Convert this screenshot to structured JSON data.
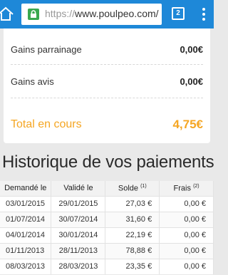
{
  "browser": {
    "url_scheme": "https://",
    "url_host": "www.poulpeo.com/",
    "tab_count": "2"
  },
  "summary": {
    "rows": [
      {
        "label": "Gains parrainage",
        "value": "0,00€"
      },
      {
        "label": "Gains avis",
        "value": "0,00€"
      }
    ],
    "total_label": "Total en cours",
    "total_value": "4,75€"
  },
  "history": {
    "title": "Historique de vos paiements",
    "columns": [
      "Demandé le",
      "Validé le",
      "Solde",
      "Frais"
    ],
    "footnotes": [
      "(1)",
      "(2)"
    ],
    "rows": [
      [
        "03/01/2015",
        "29/01/2015",
        "27,03 €",
        "0,00 €"
      ],
      [
        "01/07/2014",
        "30/07/2014",
        "31,60 €",
        "0,00 €"
      ],
      [
        "04/01/2014",
        "30/01/2014",
        "22,19 €",
        "0,00 €"
      ],
      [
        "01/11/2013",
        "28/11/2013",
        "78,88 €",
        "0,00 €"
      ],
      [
        "08/03/2013",
        "28/03/2013",
        "23,35 €",
        "0,00 €"
      ]
    ]
  },
  "colors": {
    "chrome": "#1e88d8",
    "accent": "#f5a623",
    "lock": "#3aa84f"
  }
}
